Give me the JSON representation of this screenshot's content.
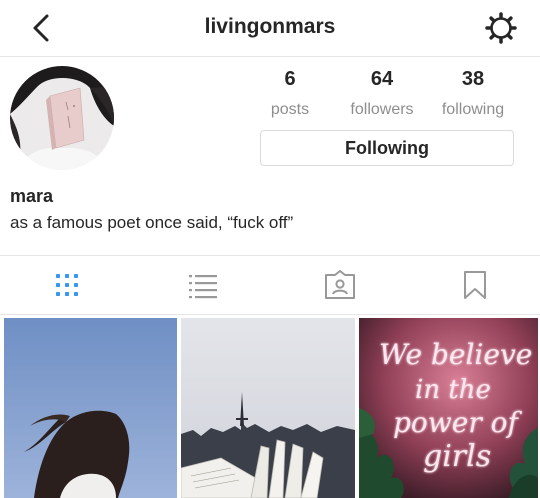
{
  "header": {
    "username": "livingonmars"
  },
  "stats": {
    "posts": {
      "value": "6",
      "label": "posts"
    },
    "followers": {
      "value": "64",
      "label": "followers"
    },
    "following": {
      "value": "38",
      "label": "following"
    }
  },
  "profile": {
    "following_button_label": "Following",
    "name": "mara",
    "bio": "as a famous poet once said, “fuck off”"
  },
  "tabs": [
    "grid",
    "list",
    "tagged",
    "saved"
  ],
  "tab_active_color": "#3897f0",
  "tab_inactive_color": "#999999",
  "posts": [
    {
      "scene": "woman with windswept hair against blue sky"
    },
    {
      "scene": "open book in front of the Paris skyline"
    },
    {
      "scene": "pink neon sign with plants"
    }
  ],
  "neon_sign": {
    "line1": "We believe",
    "line2": "in the",
    "line3": "power of",
    "line4": "girls"
  }
}
